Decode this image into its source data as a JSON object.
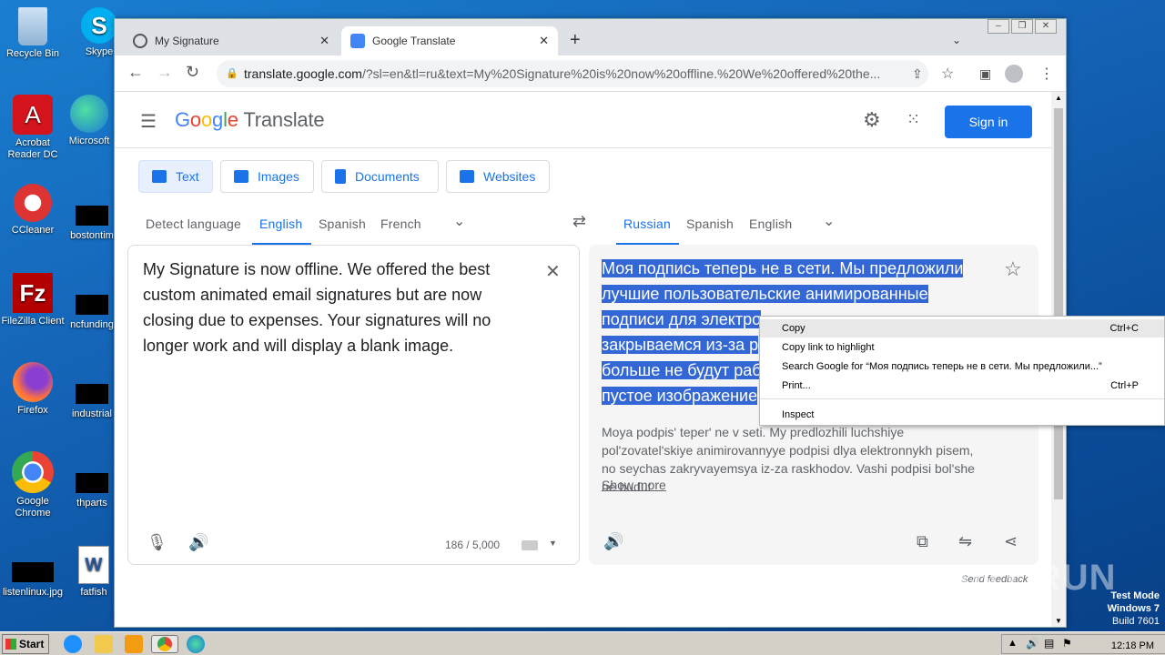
{
  "desktop": {
    "icons": [
      {
        "label": "Recycle Bin"
      },
      {
        "label": "Skype"
      },
      {
        "label": "Acrobat Reader DC"
      },
      {
        "label": "Microsoft"
      },
      {
        "label": "CCleaner"
      },
      {
        "label": "bostontim"
      },
      {
        "label": "FileZilla Client"
      },
      {
        "label": "ncfunding"
      },
      {
        "label": "Firefox"
      },
      {
        "label": "industrial"
      },
      {
        "label": "Google Chrome"
      },
      {
        "label": "thparts"
      },
      {
        "label": "listenlinux.jpg"
      },
      {
        "label": "fatfish"
      }
    ]
  },
  "browser": {
    "tabs": [
      {
        "title": "My Signature",
        "active": false
      },
      {
        "title": "Google Translate",
        "active": true
      }
    ],
    "new_tab": "+",
    "url_main": "translate.google.com",
    "url_rest": "/?sl=en&tl=ru&text=My%20Signature%20is%20now%20offline.%20We%20offered%20the..."
  },
  "translate": {
    "logo_word": "Translate",
    "sign_in": "Sign in",
    "modes": [
      "Text",
      "Images",
      "Documents",
      "Websites"
    ],
    "source_langs": [
      "Detect language",
      "English",
      "Spanish",
      "French"
    ],
    "target_langs": [
      "Russian",
      "Spanish",
      "English"
    ],
    "source_text": "My Signature is now offline. We offered the best custom animated email signatures but are now closing due to expenses. Your signatures will no longer work and will display a blank image.",
    "target_text": "Моя подпись теперь не в сети. Мы предложили лучшие пользовательские анимированные подписи для электро ... закрываемся из-за р... больше не будут раб... пустое изображение",
    "target_lines": [
      "Моя подпись теперь не в сети. Мы предложили",
      "лучшие пользовательские анимированные",
      "подписи для электро",
      "закрываемся из-за р",
      "больше не будут раб",
      "пустое изображение"
    ],
    "transliteration": "Moya podpis' teper' ne v seti. My predlozhili luchshiye pol'zovatel'skiye animirovannyye podpisi dlya elektronnykh pisem, no seychas zakryvayemsya iz-za raskhodov. Vashi podpisi bol'she ne budut",
    "show_more": "Show more",
    "char_count": "186 / 5,000",
    "send_feedback": "Send feedback"
  },
  "context_menu": {
    "items": [
      {
        "label": "Copy",
        "shortcut": "Ctrl+C"
      },
      {
        "label": "Copy link to highlight",
        "shortcut": ""
      },
      {
        "label": "Search Google for “Моя подпись теперь не в сети. Мы предложили...”",
        "shortcut": ""
      },
      {
        "label": "Print...",
        "shortcut": "Ctrl+P"
      },
      {
        "label": "Inspect",
        "shortcut": ""
      }
    ]
  },
  "taskbar": {
    "start": "Start",
    "clock": "12:18 PM"
  },
  "watermark": {
    "line1": "Test Mode",
    "line2": "Windows 7",
    "line3": "Build 7601",
    "brand": "ANY RUN"
  }
}
